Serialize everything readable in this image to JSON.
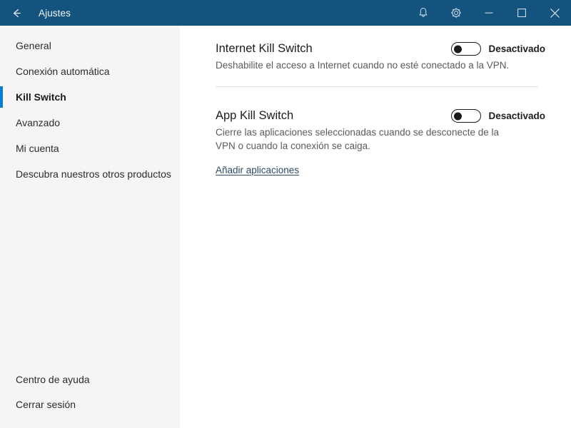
{
  "titlebar": {
    "back_icon": "back-arrow-icon",
    "title": "Ajustes",
    "notifications_icon": "bell-icon",
    "settings_icon": "gear-icon",
    "minimize_icon": "minimize-icon",
    "maximize_icon": "maximize-icon",
    "close_icon": "close-icon",
    "background_color": "#15537f",
    "text_color": "#f2f6fa"
  },
  "sidebar": {
    "background_color": "#f5f5f5",
    "accent_color": "#0a7cd4",
    "items": [
      {
        "label": "General",
        "selected": false
      },
      {
        "label": "Conexión automática",
        "selected": false
      },
      {
        "label": "Kill Switch",
        "selected": true
      },
      {
        "label": "Avanzado",
        "selected": false
      },
      {
        "label": "Mi cuenta",
        "selected": false
      },
      {
        "label": "Descubra nuestros otros productos",
        "selected": false
      }
    ],
    "footer_items": [
      {
        "label": "Centro de ayuda"
      },
      {
        "label": "Cerrar sesión"
      }
    ]
  },
  "main": {
    "settings": [
      {
        "title": "Internet Kill Switch",
        "description": "Deshabilite el acceso a Internet cuando no esté conectado a la VPN.",
        "toggle_state": "off",
        "toggle_label": "Desactivado"
      },
      {
        "title": "App Kill Switch",
        "description": "Cierre las aplicaciones seleccionadas cuando se desconecte de la VPN o cuando la conexión se caiga.",
        "toggle_state": "off",
        "toggle_label": "Desactivado",
        "link_label": "Añadir aplicaciones"
      }
    ]
  }
}
